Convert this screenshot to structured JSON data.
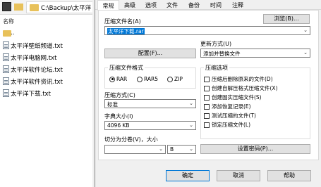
{
  "explorer": {
    "address": "C:\\Backup\\太平洋",
    "column_header": "名称",
    "items": [
      {
        "name": "..",
        "kind": "folder"
      },
      {
        "name": "太平洋壁纸频道.txt",
        "kind": "file"
      },
      {
        "name": "太平洋电脑网.txt",
        "kind": "file"
      },
      {
        "name": "太平洋软件论坛.txt",
        "kind": "file"
      },
      {
        "name": "太平洋软件资讯.txt",
        "kind": "file"
      },
      {
        "name": "太平洋下载.txt",
        "kind": "file"
      }
    ]
  },
  "dialog": {
    "tabs": [
      "常规",
      "高级",
      "选项",
      "文件",
      "备份",
      "时间",
      "注释"
    ],
    "active_tab": 0,
    "archive_name_label": "压缩文件名(A)",
    "archive_name_value": "太平洋下载.rar",
    "browse_button": "浏览(B)...",
    "update_mode_label": "更新方式(U)",
    "update_mode_value": "添加并替换文件",
    "profiles_button": "配置(F)...",
    "format_group": "压缩文件格式",
    "formats": [
      "RAR",
      "RAR5",
      "ZIP"
    ],
    "selected_format": 0,
    "options_group": "压缩选项",
    "options": [
      "压缩后删除原来的文件(D)",
      "创建自解压格式压缩文件(X)",
      "创建固实压缩文件(S)",
      "添加恢复记录(E)",
      "测试压缩的文件(T)",
      "锁定压缩文件(L)"
    ],
    "method_label": "压缩方式(C)",
    "method_value": "标准",
    "dict_label": "字典大小(I)",
    "dict_value": "4096 KB",
    "split_label": "切分为分卷(V)，大小",
    "split_value": "",
    "split_unit": "B",
    "password_button": "设置密码(P)...",
    "ok_button": "确定",
    "cancel_button": "取消",
    "help_button": "帮助"
  }
}
